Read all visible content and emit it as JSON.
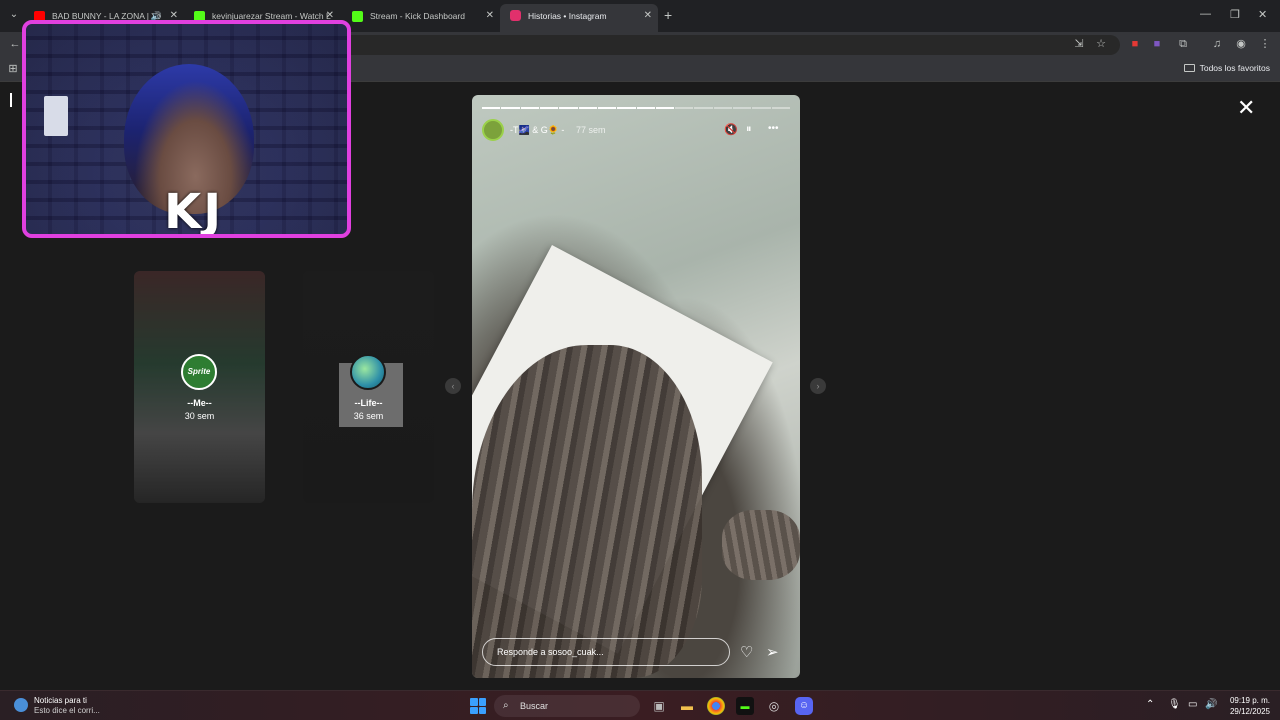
{
  "browser": {
    "tabs": [
      {
        "label": "BAD BUNNY - LA ZONA | Yo",
        "fav_color": "#ff0000",
        "audio": "🔊"
      },
      {
        "label": "kevinjuarezar Stream - Watch L",
        "fav_color": "#53fc18"
      },
      {
        "label": "Stream - Kick Dashboard",
        "fav_color": "#53fc18"
      },
      {
        "label": "Historias • Instagram",
        "fav_color": "#e1306c"
      }
    ],
    "new_tab": "+",
    "window_controls": {
      "minimize": "—",
      "restore": "❐",
      "close": "✕"
    },
    "bookmarks_folder": "Todos los favoritos"
  },
  "stream_overlay": {
    "badge": "KJ"
  },
  "stories": [
    {
      "name": "--Me--",
      "time": "30 sem",
      "avatar_label": "Sprite",
      "avatar_color": "#2e7d32"
    },
    {
      "name": "--Life--",
      "time": "36 sem",
      "avatar_label": "",
      "avatar_color": "#2e8fa8"
    }
  ],
  "current_story": {
    "user": "-T🌌 & G🌻 -",
    "time": "77 sem",
    "progress_segments": 16,
    "progress_done": 10,
    "reply_placeholder": "Responde a sosoo_cuak...",
    "mute_icon": "🔇",
    "pause_icon": "⏸",
    "more_icon": "•••"
  },
  "close_label": "✕",
  "taskbar": {
    "news_title": "Noticias para ti",
    "news_sub": "Esto dice el corri...",
    "search_label": "Buscar",
    "time": "09:19 p. m.",
    "date": "29/12/2025"
  }
}
